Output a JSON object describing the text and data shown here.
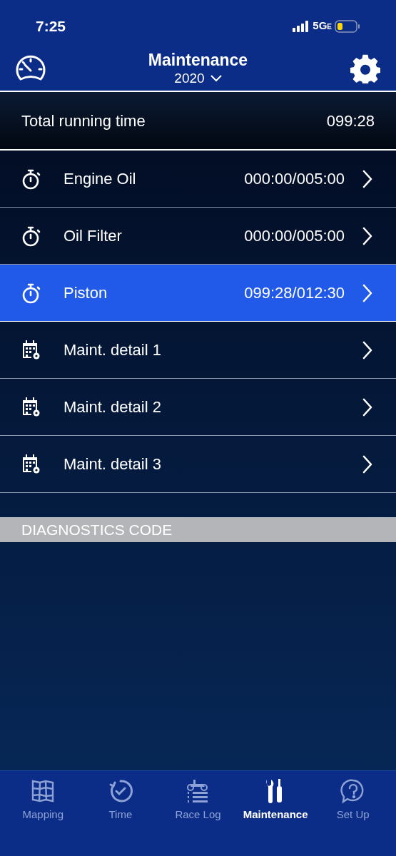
{
  "status_bar": {
    "time": "7:25",
    "network": "5G",
    "network_suffix": "E"
  },
  "header": {
    "title": "Maintenance",
    "year": "2020"
  },
  "total": {
    "label": "Total running time",
    "value": "099:28"
  },
  "items": [
    {
      "kind": "timer",
      "label": "Engine Oil",
      "value": "000:00/005:00",
      "selected": false
    },
    {
      "kind": "timer",
      "label": "Oil Filter",
      "value": "000:00/005:00",
      "selected": false
    },
    {
      "kind": "timer",
      "label": "Piston",
      "value": "099:28/012:30",
      "selected": true
    },
    {
      "kind": "detail",
      "label": "Maint. detail 1",
      "selected": false
    },
    {
      "kind": "detail",
      "label": "Maint. detail 2",
      "selected": false
    },
    {
      "kind": "detail",
      "label": "Maint. detail 3",
      "selected": false
    }
  ],
  "section": {
    "title": "DIAGNOSTICS CODE"
  },
  "tabs": [
    {
      "kind": "map",
      "label": "Mapping",
      "selected": false
    },
    {
      "kind": "time",
      "label": "Time",
      "selected": false
    },
    {
      "kind": "log",
      "label": "Race Log",
      "selected": false
    },
    {
      "kind": "tools",
      "label": "Maintenance",
      "selected": true
    },
    {
      "kind": "help",
      "label": "Set Up",
      "selected": false
    }
  ]
}
